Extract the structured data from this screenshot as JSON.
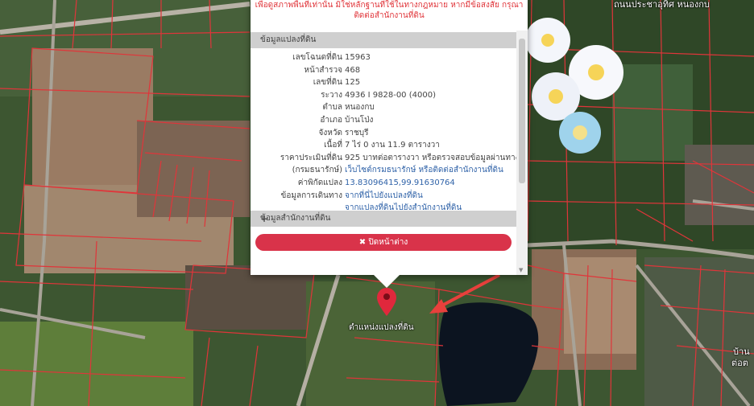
{
  "colors": {
    "parcel_line": "#e0353a",
    "accent_red": "#d9334a",
    "link_blue": "#2f62a8",
    "section_gray": "#cfcfcf"
  },
  "popup": {
    "notice_line1": "เพื่อดูสภาพพื้นที่เท่านั้น มิใช่หลักฐานที่ใช้ในทางกฎหมาย หากมีข้อสงสัย กรุณา",
    "notice_line2": "ติดต่อสำนักงานที่ดิน",
    "section_parcel": "ข้อมูลแปลงที่ดิน",
    "section_office": "ข้อมูลสำนักงานที่ดิน",
    "rows": [
      {
        "label": "เลขโฉนดที่ดิน",
        "value": "15963"
      },
      {
        "label": "หน้าสำรวจ",
        "value": "468"
      },
      {
        "label": "เลขที่ดิน",
        "value": "125"
      },
      {
        "label": "ระวาง",
        "value": "4936 I 9828-00 (4000)"
      },
      {
        "label": "ตำบล",
        "value": "หนองกบ"
      },
      {
        "label": "อำเภอ",
        "value": "บ้านโป่ง"
      },
      {
        "label": "จังหวัด",
        "value": "ราชบุรี"
      },
      {
        "label": "เนื้อที่",
        "value": "7 ไร่ 0 งาน 11.9 ตารางวา"
      },
      {
        "label": "ราคาประเมินที่ดิน",
        "value": "925 บาทต่อตารางวา หรือตรวจสอบข้อมูลผ่านทาง"
      },
      {
        "label": "(กรมธนารักษ์)",
        "value": "เว็บไซต์กรมธนารักษ์ หรือติดต่อสำนักงานที่ดิน"
      },
      {
        "label": "ค่าพิกัดแปลง",
        "value": "13.83096415,99.91630764"
      },
      {
        "label": "ข้อมูลการเดินทาง",
        "value": "จากที่นี่ไปยังแปลงที่ดิน"
      },
      {
        "label": "",
        "value": "จากแปลงที่ดินไปยังสำนักงานที่ดิน"
      }
    ],
    "close_label": "✖ ปิดหน้าต่าง"
  },
  "map": {
    "pin_label": "ตำแหน่งแปลงที่ดิน",
    "top_right_label": "ถนนประชาอุทิศ หนองกบ",
    "bottom_right_label_1": "บ้าน",
    "bottom_right_label_2": "ต่อต"
  }
}
